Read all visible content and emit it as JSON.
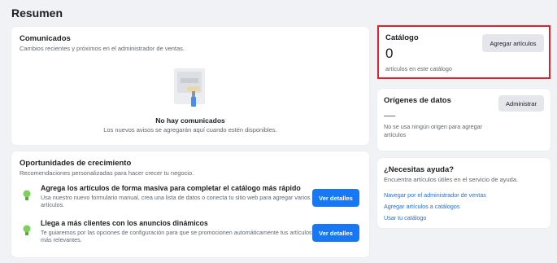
{
  "page": {
    "title": "Resumen"
  },
  "comunicados": {
    "title": "Comunicados",
    "subtitle": "Cambios recientes y próximos en el administrador de ventas.",
    "empty_title": "No hay comunicados",
    "empty_subtitle": "Los nuevos avisos se agregarán aquí cuando estén disponibles."
  },
  "oportunidades": {
    "title": "Oportunidades de crecimiento",
    "subtitle": "Recomendaciones personalizadas para hacer crecer tu negocio.",
    "items": [
      {
        "title": "Agrega los artículos de forma masiva para completar el catálogo más rápido",
        "description": "Usa nuestro nuevo formulario manual, crea una lista de datos o conecta tu sitio web para agregar varios artículos.",
        "button": "Ver detalles"
      },
      {
        "title": "Llega a más clientes con los anuncios dinámicos",
        "description": "Te guiaremos por las opciones de configuración para que se promocionen automáticamente tus artículos más relevantes.",
        "button": "Ver detalles"
      }
    ]
  },
  "catalogo": {
    "title": "Catálogo",
    "count": "0",
    "subtitle": "artículos en este catálogo",
    "button": "Agregar artículos"
  },
  "origenes": {
    "title": "Orígenes de datos",
    "value": "—",
    "subtitle": "No se usa ningún origen para agregar artículos",
    "button": "Administrar"
  },
  "ayuda": {
    "title": "¿Necesitas ayuda?",
    "subtitle": "Encuentra artículos útiles en el servicio de ayuda.",
    "links": [
      "Navegar por el administrador de ventas",
      "Agregar artículos a catálogos",
      "Usar tu catálogo"
    ]
  },
  "colors": {
    "primary": "#1877f2",
    "link": "#216fdb",
    "highlight": "#d72630",
    "background": "#f0f2f5"
  },
  "icons": {
    "empty_state": "paint-roller-illustration",
    "opportunity": "lightbulb-icon"
  }
}
